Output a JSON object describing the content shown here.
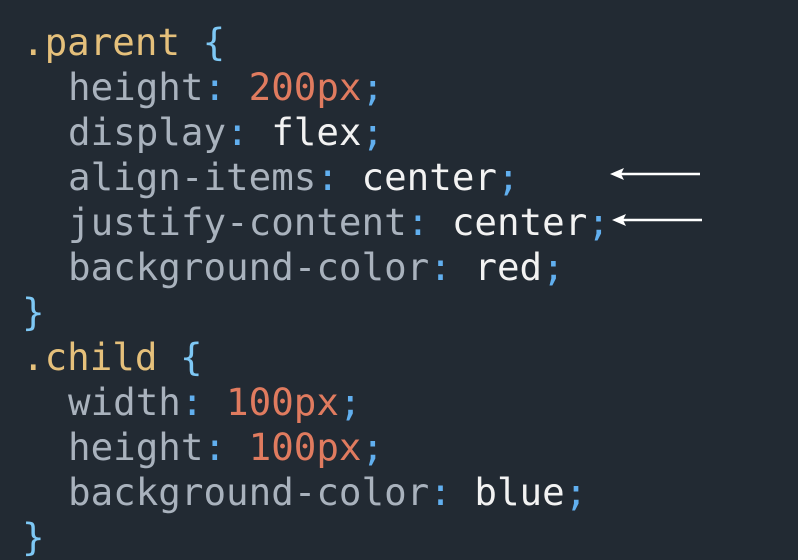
{
  "code": {
    "parent_selector": ".parent",
    "open_brace": "{",
    "close_brace": "}",
    "colon": ":",
    "semicolon": ";",
    "parent_rules": [
      {
        "property": "height",
        "value": "200px",
        "value_type": "number"
      },
      {
        "property": "display",
        "value": "flex",
        "value_type": "keyword"
      },
      {
        "property": "align-items",
        "value": "center",
        "value_type": "keyword"
      },
      {
        "property": "justify-content",
        "value": "center",
        "value_type": "keyword"
      },
      {
        "property": "background-color",
        "value": "red",
        "value_type": "keyword"
      }
    ],
    "child_selector": ".child",
    "child_rules": [
      {
        "property": "width",
        "value": "100px",
        "value_type": "number"
      },
      {
        "property": "height",
        "value": "100px",
        "value_type": "number"
      },
      {
        "property": "background-color",
        "value": "blue",
        "value_type": "keyword"
      }
    ]
  },
  "annotations": {
    "arrow_icon": "left-arrow-icon",
    "arrow_color": "#ffffff",
    "highlighted_lines": [
      "align-items",
      "justify-content"
    ]
  },
  "colors": {
    "background": "#222a33",
    "selector": "#e5c07b",
    "property": "#a9b2bd",
    "number": "#e07b5f",
    "keyword": "#f2f2f2",
    "punctuation": "#61afef"
  }
}
